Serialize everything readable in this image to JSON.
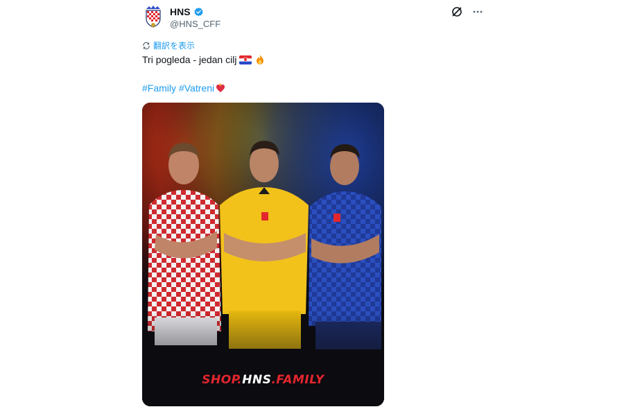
{
  "author": {
    "display_name": "HNS",
    "handle": "@HNS_CFF",
    "avatar_icon": "hns-crest-icon",
    "verified_icon": "verified-badge-icon",
    "verified_color": "#1d9bf0"
  },
  "actions": {
    "grok_icon": "grok-icon",
    "more_icon": "more-dots-icon"
  },
  "translate": {
    "label": "翻訳を表示",
    "icon": "translate-icon"
  },
  "tweet": {
    "text": "Tri pogleda - jedan cilj",
    "emojis": [
      "croatia-flag",
      "fire"
    ],
    "hashtags": [
      "#Family",
      "#Vatreni"
    ],
    "hashtag_emoji": "heart-on-fire"
  },
  "media": {
    "shop_part1": "SHOP.",
    "shop_part2": "HNS",
    "shop_part3": ".FAMILY",
    "colors": {
      "red": "#e3262d",
      "yellow": "#f2c21b",
      "blue": "#2a49c7",
      "background": "#0b0b10"
    }
  },
  "colors": {
    "link": "#1d9bf0",
    "text": "#0f1419",
    "secondary": "#536471"
  }
}
